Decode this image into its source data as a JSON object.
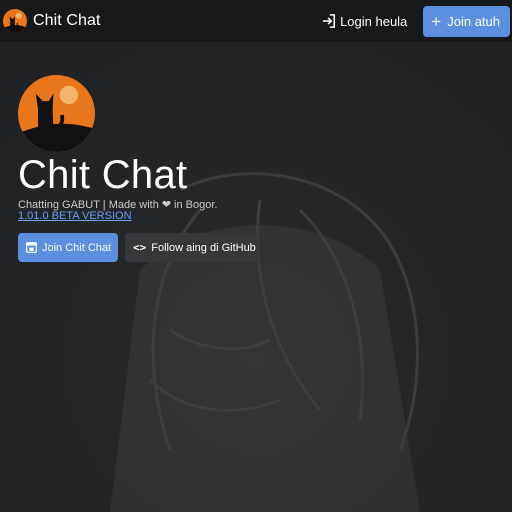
{
  "navbar": {
    "brand_text": "Chit Chat",
    "brand_icon": "cat-sunset-logo",
    "login_label": "Login heula",
    "login_icon": "sign-in-icon",
    "join_label": "Join atuh",
    "join_icon": "plus-icon"
  },
  "hero": {
    "title": "Chit Chat",
    "tagline_before": "Chatting GABUT | Made with",
    "tagline_after": "in Bogor.",
    "heart_icon": "heart-icon",
    "version": "1.01.0 BETA VERSION",
    "join_button": "Join Chit Chat",
    "join_button_icon": "door-icon",
    "github_button": "Follow aing di GitHub",
    "github_button_icon": "code-icon"
  },
  "colors": {
    "accent": "#5d8fe0",
    "navbar_bg": "#16181a",
    "page_bg": "#232629",
    "logo_orange": "#e8761c",
    "link": "#6d9ef0"
  }
}
